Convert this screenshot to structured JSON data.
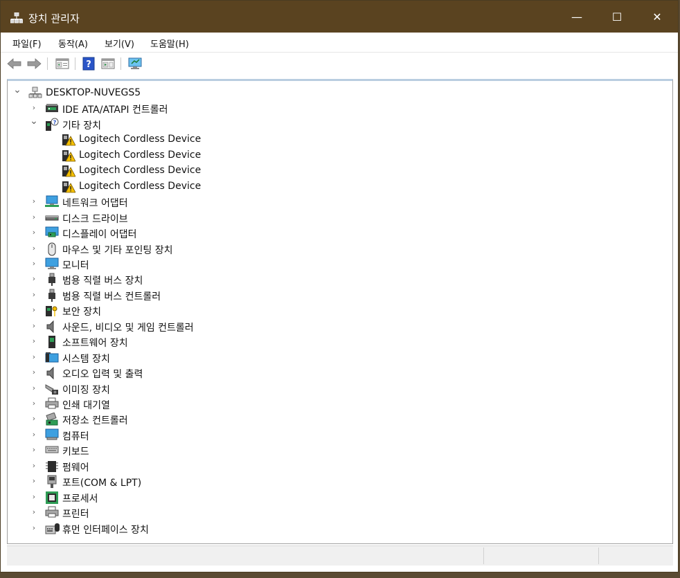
{
  "window": {
    "title": "장치 관리자",
    "minimize": "—",
    "maximize": "☐",
    "close": "✕"
  },
  "menu": [
    {
      "label": "파일(F)"
    },
    {
      "label": "동작(A)"
    },
    {
      "label": "보기(V)"
    },
    {
      "label": "도움말(H)"
    }
  ],
  "toolbar": {
    "buttons": [
      "back-icon",
      "forward-icon",
      "properties-icon",
      "help-icon",
      "show-hide-icon",
      "scan-hardware-icon"
    ]
  },
  "tree": {
    "root": {
      "label": "DESKTOP-NUVEGS5",
      "icon": "computer-root-icon",
      "expanded": true
    },
    "items": [
      {
        "label": "IDE ATA/ATAPI 컨트롤러",
        "icon": "ide-controller-icon",
        "expanded": false
      },
      {
        "label": "기타 장치",
        "icon": "other-devices-icon",
        "expanded": true,
        "children": [
          {
            "label": "Logitech Cordless Device",
            "icon": "warning-device-icon"
          },
          {
            "label": "Logitech Cordless Device",
            "icon": "warning-device-icon"
          },
          {
            "label": "Logitech Cordless Device",
            "icon": "warning-device-icon"
          },
          {
            "label": "Logitech Cordless Device",
            "icon": "warning-device-icon"
          }
        ]
      },
      {
        "label": "네트워크 어댑터",
        "icon": "network-adapter-icon",
        "expanded": false
      },
      {
        "label": "디스크 드라이브",
        "icon": "disk-drive-icon",
        "expanded": false
      },
      {
        "label": "디스플레이 어댑터",
        "icon": "display-adapter-icon",
        "expanded": false
      },
      {
        "label": "마우스 및 기타 포인팅 장치",
        "icon": "mouse-icon",
        "expanded": false
      },
      {
        "label": "모니터",
        "icon": "monitor-icon",
        "expanded": false
      },
      {
        "label": "범용 직렬 버스 장치",
        "icon": "usb-icon",
        "expanded": false
      },
      {
        "label": "범용 직렬 버스 컨트롤러",
        "icon": "usb-icon",
        "expanded": false
      },
      {
        "label": "보안 장치",
        "icon": "security-icon",
        "expanded": false
      },
      {
        "label": "사운드, 비디오 및 게임 컨트롤러",
        "icon": "speaker-icon",
        "expanded": false
      },
      {
        "label": "소프트웨어 장치",
        "icon": "software-device-icon",
        "expanded": false
      },
      {
        "label": "시스템 장치",
        "icon": "system-folder-icon",
        "expanded": false
      },
      {
        "label": "오디오 입력 및 출력",
        "icon": "speaker-icon",
        "expanded": false
      },
      {
        "label": "이미징 장치",
        "icon": "camera-icon",
        "expanded": false
      },
      {
        "label": "인쇄 대기열",
        "icon": "printer-icon",
        "expanded": false
      },
      {
        "label": "저장소 컨트롤러",
        "icon": "storage-controller-icon",
        "expanded": false
      },
      {
        "label": "컴퓨터",
        "icon": "computer-icon",
        "expanded": false
      },
      {
        "label": "키보드",
        "icon": "keyboard-icon",
        "expanded": false
      },
      {
        "label": "펌웨어",
        "icon": "firmware-icon",
        "expanded": false
      },
      {
        "label": "포트(COM & LPT)",
        "icon": "port-icon",
        "expanded": false
      },
      {
        "label": "프로세서",
        "icon": "processor-icon",
        "expanded": false
      },
      {
        "label": "프린터",
        "icon": "printer-icon",
        "expanded": false
      },
      {
        "label": "휴먼 인터페이스 장치",
        "icon": "hid-icon",
        "expanded": false
      }
    ]
  },
  "colors": {
    "titlebar": "#5a4320",
    "selection_border": "#b9cde0",
    "warning": "#f5c000"
  }
}
